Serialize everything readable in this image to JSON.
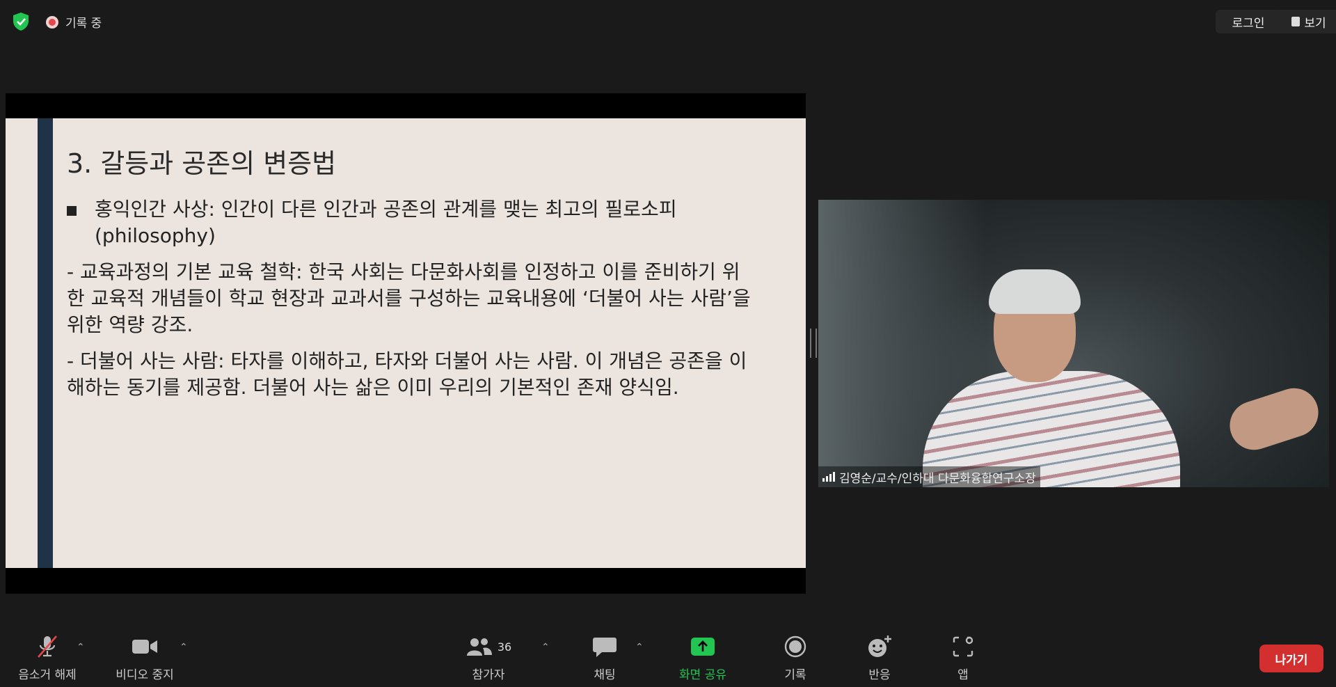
{
  "topbar": {
    "recording_label": "기록 중",
    "login_label": "로그인",
    "view_label": "보기"
  },
  "slide": {
    "title": "3. 갈등과 공존의 변증법",
    "bullet": "홍익인간 사상: 인간이 다른 인간과 공존의 관계를 맺는 최고의 필로소피(philosophy)",
    "para1": "- 교육과정의 기본 교육 철학: 한국 사회는 다문화사회를 인정하고 이를 준비하기 위한 교육적 개념들이 학교 현장과 교과서를 구성하는 교육내용에 ‘더불어 사는 사람’을 위한 역량 강조.",
    "para2": "- 더불어 사는 사람: 타자를 이해하고, 타자와 더불어 사는 사람. 이 개념은 공존을 이해하는 동기를 제공함. 더불어 사는 삶은 이미 우리의 기본적인 존재 양식임."
  },
  "video": {
    "participant_name": "김영순/교수/인하대 다문화융합연구소장"
  },
  "toolbar": {
    "mute_label": "음소거 해제",
    "video_label": "비디오 중지",
    "participants_label": "참가자",
    "participants_count": "36",
    "chat_label": "채팅",
    "share_label": "화면 공유",
    "record_label": "기록",
    "reactions_label": "반응",
    "apps_label": "앱",
    "leave_label": "나가기"
  },
  "colors": {
    "share_green": "#23c552",
    "leave_red": "#d32f2f",
    "slide_bg": "#ece5df",
    "slide_bar": "#1f3246"
  }
}
